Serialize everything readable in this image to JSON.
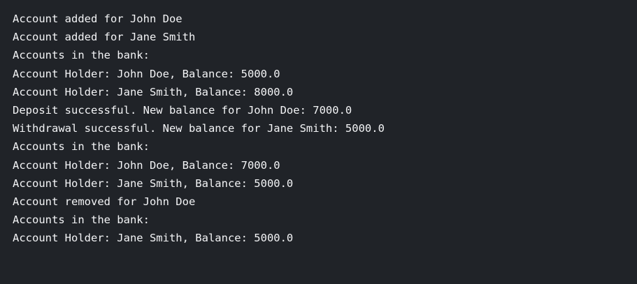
{
  "theme": {
    "background": "#202328",
    "text": "#f3f4f6"
  },
  "output": {
    "lines": [
      "Account added for John Doe",
      "Account added for Jane Smith",
      "Accounts in the bank:",
      "Account Holder: John Doe, Balance: 5000.0",
      "Account Holder: Jane Smith, Balance: 8000.0",
      "Deposit successful. New balance for John Doe: 7000.0",
      "Withdrawal successful. New balance for Jane Smith: 5000.0",
      "Accounts in the bank:",
      "Account Holder: John Doe, Balance: 7000.0",
      "Account Holder: Jane Smith, Balance: 5000.0",
      "Account removed for John Doe",
      "Accounts in the bank:",
      "Account Holder: Jane Smith, Balance: 5000.0"
    ]
  }
}
